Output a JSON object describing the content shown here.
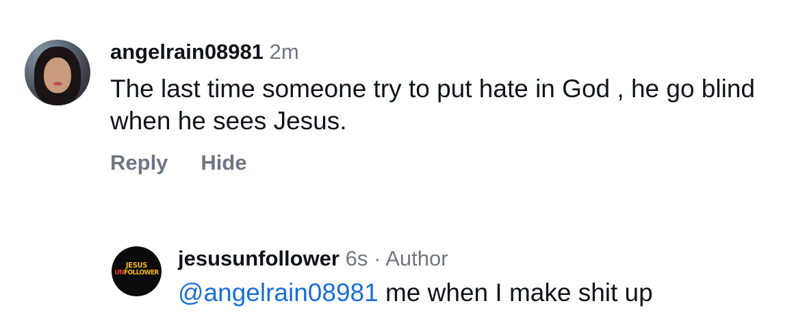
{
  "comments": [
    {
      "username": "angelrain08981",
      "time": "2m",
      "text": "The last time someone try to put hate in God , he go blind when he sees Jesus.",
      "actions": {
        "reply": "Reply",
        "hide": "Hide"
      }
    },
    {
      "username": "jesusunfollower",
      "time": "6s",
      "separator": "·",
      "role": "Author",
      "mention": "@angelrain08981",
      "text": "me when I make shit up",
      "avatar_text": {
        "line1": "JESUS",
        "line2_red": "UN",
        "line2": "FOLLOWER"
      }
    }
  ],
  "colors": {
    "mention": "#1a6ed8",
    "meta": "#6e7681",
    "logo_gold": "#f2b418",
    "logo_red": "#e23a2c"
  }
}
